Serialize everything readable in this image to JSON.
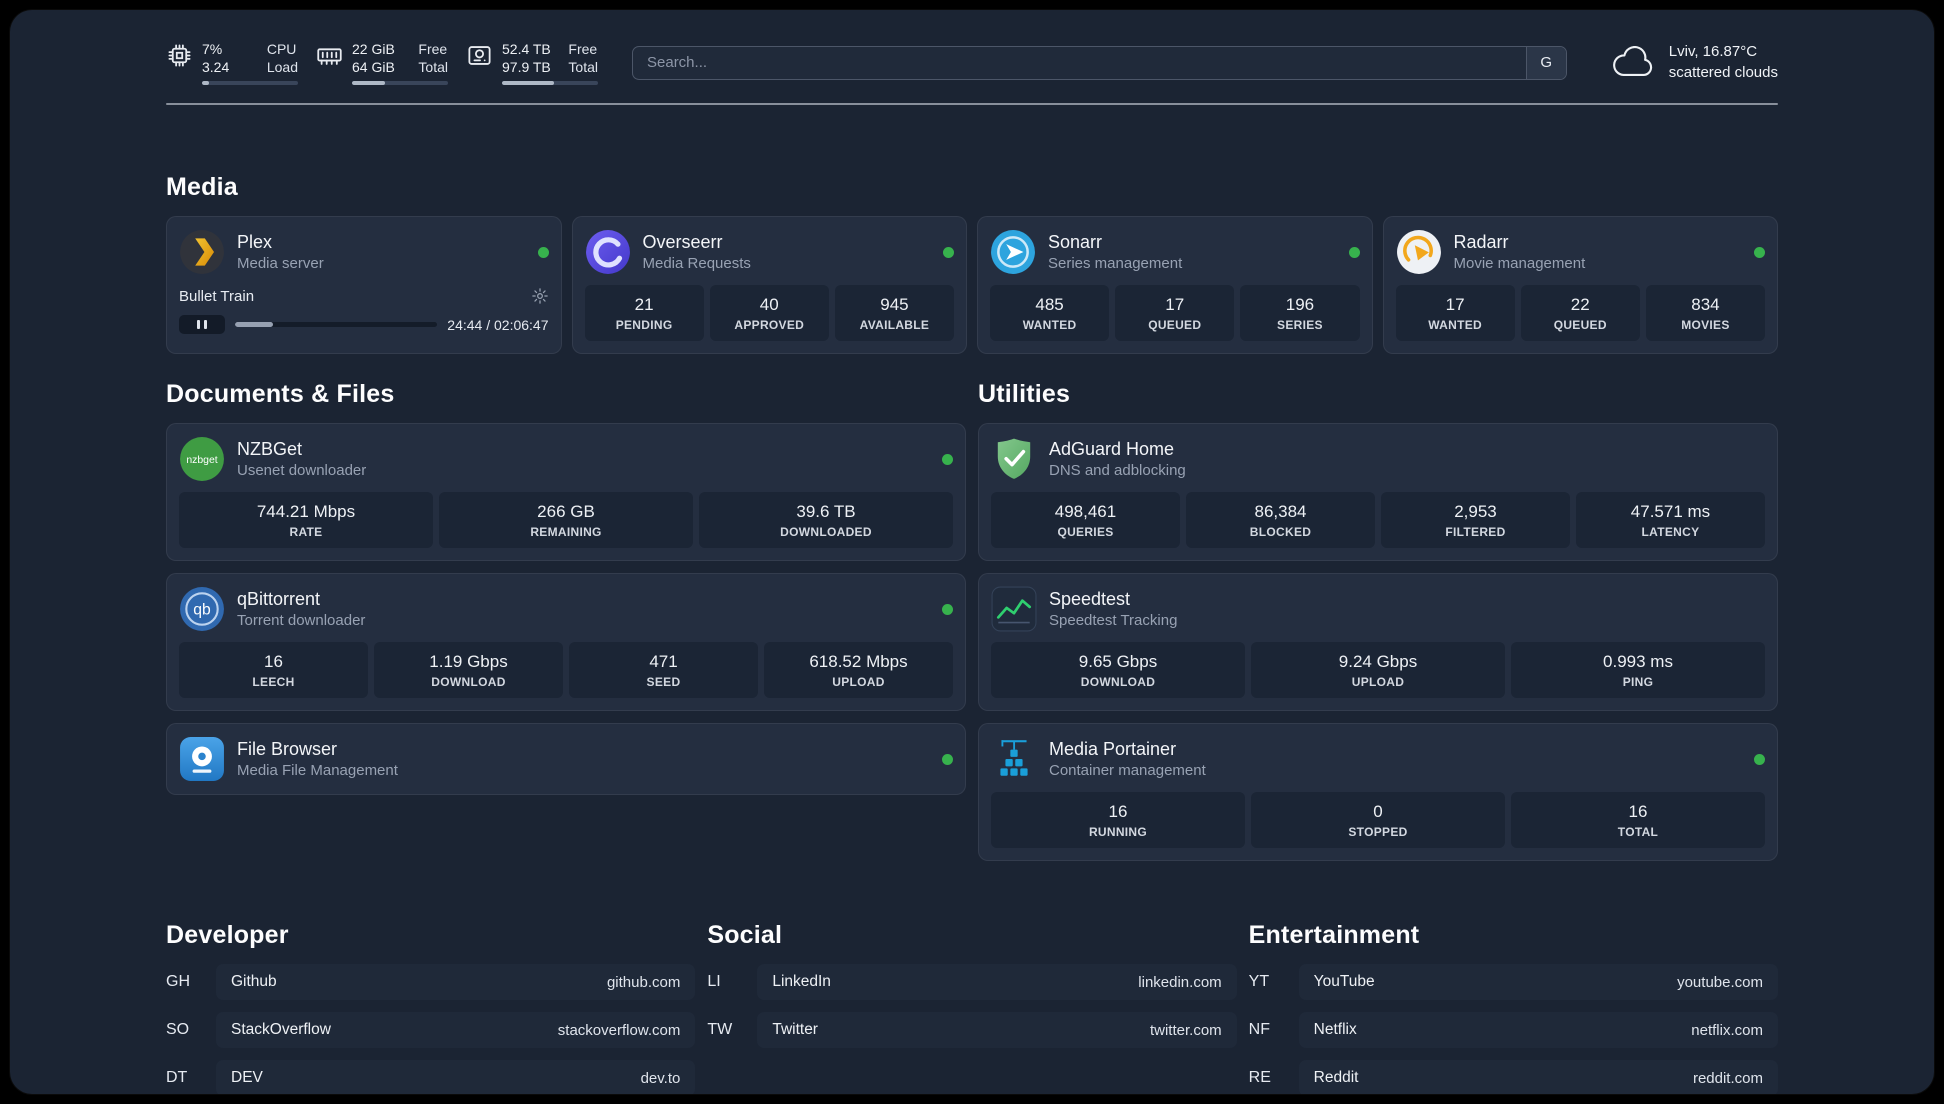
{
  "topbar": {
    "cpu": {
      "value_top": "7%",
      "value_bottom": "3.24",
      "label_top": "CPU",
      "label_bottom": "Load",
      "progress": 7
    },
    "ram": {
      "value_top": "22 GiB",
      "value_bottom": "64 GiB",
      "label_top": "Free",
      "label_bottom": "Total",
      "progress": 34
    },
    "disk": {
      "value_top": "52.4 TB",
      "value_bottom": "97.9 TB",
      "label_top": "Free",
      "label_bottom": "Total",
      "progress": 54
    },
    "search": {
      "placeholder": "Search...",
      "engine_label": "G"
    },
    "weather": {
      "location": "Lviv, 16.87°C",
      "condition": "scattered clouds"
    }
  },
  "sections": {
    "media": "Media",
    "documents": "Documents & Files",
    "utilities": "Utilities"
  },
  "apps": {
    "plex": {
      "name": "Plex",
      "subtitle": "Media server",
      "player": {
        "track": "Bullet Train",
        "time": "24:44 / 02:06:47",
        "progress": 19
      }
    },
    "overseerr": {
      "name": "Overseerr",
      "subtitle": "Media Requests",
      "stats": [
        {
          "value": "21",
          "label": "PENDING"
        },
        {
          "value": "40",
          "label": "APPROVED"
        },
        {
          "value": "945",
          "label": "AVAILABLE"
        }
      ]
    },
    "sonarr": {
      "name": "Sonarr",
      "subtitle": "Series management",
      "stats": [
        {
          "value": "485",
          "label": "WANTED"
        },
        {
          "value": "17",
          "label": "QUEUED"
        },
        {
          "value": "196",
          "label": "SERIES"
        }
      ]
    },
    "radarr": {
      "name": "Radarr",
      "subtitle": "Movie management",
      "stats": [
        {
          "value": "17",
          "label": "WANTED"
        },
        {
          "value": "22",
          "label": "QUEUED"
        },
        {
          "value": "834",
          "label": "MOVIES"
        }
      ]
    },
    "nzbget": {
      "name": "NZBGet",
      "subtitle": "Usenet downloader",
      "icon_text": "nzbget",
      "stats": [
        {
          "value": "744.21 Mbps",
          "label": "RATE"
        },
        {
          "value": "266 GB",
          "label": "REMAINING"
        },
        {
          "value": "39.6 TB",
          "label": "DOWNLOADED"
        }
      ]
    },
    "qbittorrent": {
      "name": "qBittorrent",
      "subtitle": "Torrent downloader",
      "icon_text": "qb",
      "stats": [
        {
          "value": "16",
          "label": "LEECH"
        },
        {
          "value": "1.19 Gbps",
          "label": "DOWNLOAD"
        },
        {
          "value": "471",
          "label": "SEED"
        },
        {
          "value": "618.52 Mbps",
          "label": "UPLOAD"
        }
      ]
    },
    "filebrowser": {
      "name": "File Browser",
      "subtitle": "Media File Management"
    },
    "adguard": {
      "name": "AdGuard Home",
      "subtitle": "DNS and adblocking",
      "stats": [
        {
          "value": "498,461",
          "label": "QUERIES"
        },
        {
          "value": "86,384",
          "label": "BLOCKED"
        },
        {
          "value": "2,953",
          "label": "FILTERED"
        },
        {
          "value": "47.571 ms",
          "label": "LATENCY"
        }
      ]
    },
    "speedtest": {
      "name": "Speedtest",
      "subtitle": "Speedtest Tracking",
      "stats": [
        {
          "value": "9.65 Gbps",
          "label": "DOWNLOAD"
        },
        {
          "value": "9.24 Gbps",
          "label": "UPLOAD"
        },
        {
          "value": "0.993 ms",
          "label": "PING"
        }
      ]
    },
    "portainer": {
      "name": "Media Portainer",
      "subtitle": "Container management",
      "stats": [
        {
          "value": "16",
          "label": "RUNNING"
        },
        {
          "value": "0",
          "label": "STOPPED"
        },
        {
          "value": "16",
          "label": "TOTAL"
        }
      ]
    }
  },
  "bookmarks": {
    "developer": {
      "title": "Developer",
      "items": [
        {
          "abbr": "GH",
          "name": "Github",
          "url": "github.com"
        },
        {
          "abbr": "SO",
          "name": "StackOverflow",
          "url": "stackoverflow.com"
        },
        {
          "abbr": "DT",
          "name": "DEV",
          "url": "dev.to"
        }
      ]
    },
    "social": {
      "title": "Social",
      "items": [
        {
          "abbr": "LI",
          "name": "LinkedIn",
          "url": "linkedin.com"
        },
        {
          "abbr": "TW",
          "name": "Twitter",
          "url": "twitter.com"
        }
      ]
    },
    "entertainment": {
      "title": "Entertainment",
      "items": [
        {
          "abbr": "YT",
          "name": "YouTube",
          "url": "youtube.com"
        },
        {
          "abbr": "NF",
          "name": "Netflix",
          "url": "netflix.com"
        },
        {
          "abbr": "RE",
          "name": "Reddit",
          "url": "reddit.com"
        }
      ]
    }
  },
  "colors": {
    "status_online": "#37b24d"
  }
}
